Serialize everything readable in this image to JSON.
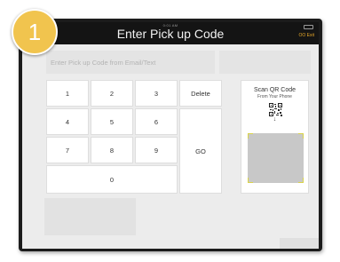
{
  "step": {
    "number": "1",
    "color": "#f1c44e"
  },
  "header": {
    "title": "Enter Pick up Code",
    "exit_label": "OO Exit",
    "status_time": "0:01 AM"
  },
  "code_input": {
    "value": "",
    "placeholder": "Enter Pick up Code from Email/Text"
  },
  "keypad": {
    "keys": [
      "1",
      "2",
      "3",
      "4",
      "5",
      "6",
      "7",
      "8",
      "9",
      "0"
    ],
    "delete_label": "Delete",
    "go_label": "GO"
  },
  "qr_panel": {
    "title": "Scan QR Code",
    "subtitle": "From Your Phone",
    "arrow": "↓",
    "qr_icon": "qr-code-icon",
    "viewfinder_color": "#d9d34a"
  },
  "colors": {
    "title_bar": "#141414",
    "screen_bg": "#ececec",
    "exit_accent": "#e7a829"
  }
}
